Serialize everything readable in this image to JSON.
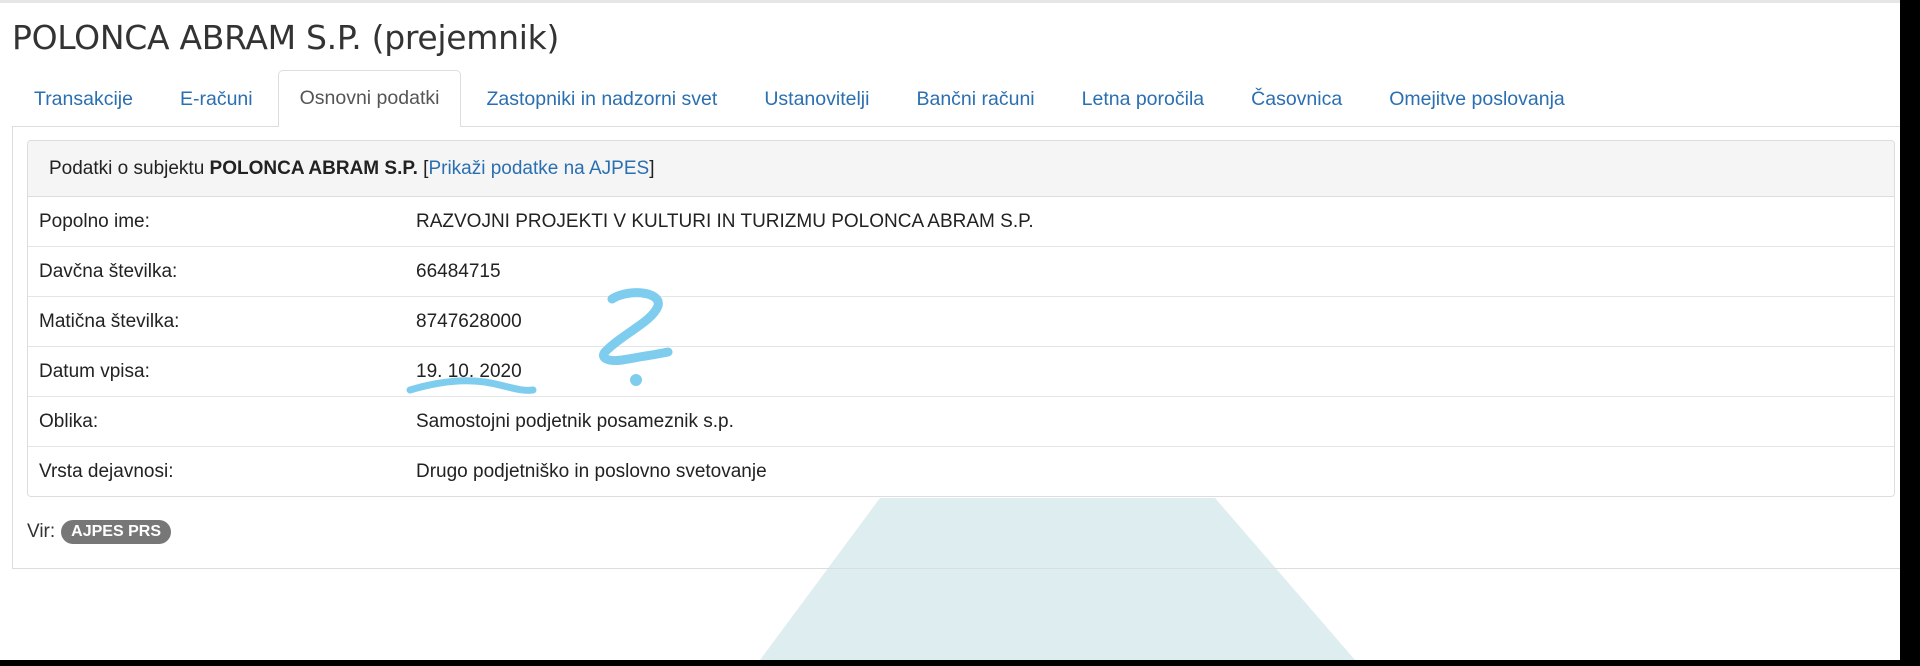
{
  "page": {
    "title": "POLONCA ABRAM S.P. (prejemnik)"
  },
  "tabs": [
    {
      "label": "Transakcije"
    },
    {
      "label": "E-računi"
    },
    {
      "label": "Osnovni podatki"
    },
    {
      "label": "Zastopniki in nadzorni svet"
    },
    {
      "label": "Ustanovitelji"
    },
    {
      "label": "Bančni računi"
    },
    {
      "label": "Letna poročila"
    },
    {
      "label": "Časovnica"
    },
    {
      "label": "Omejitve poslovanja"
    }
  ],
  "active_tab": "Osnovni podatki",
  "panel": {
    "heading_prefix": "Podatki o subjektu",
    "subject_name": "POLONCA ABRAM S.P.",
    "bracket_open": "[",
    "ajpes_link": "Prikaži podatke na AJPES",
    "bracket_close": "]"
  },
  "rows": [
    {
      "label": "Popolno ime:",
      "value": "RAZVOJNI PROJEKTI V KULTURI IN TURIZMU POLONCA ABRAM S.P."
    },
    {
      "label": "Davčna številka:",
      "value": "66484715"
    },
    {
      "label": "Matična številka:",
      "value": "8747628000"
    },
    {
      "label": "Datum vpisa:",
      "value": "19. 10. 2020"
    },
    {
      "label": "Oblika:",
      "value": "Samostojni podjetnik posameznik s.p."
    },
    {
      "label": "Vrsta dejavnosi:",
      "value": "Drugo podjetniško in poslovno svetovanje"
    }
  ],
  "source": {
    "label": "Vir:",
    "badge": "AJPES PRS"
  },
  "colors": {
    "link": "#2a6fb1",
    "badge": "#777777",
    "annotation": "#7fcdee",
    "background_shape": "#deedef"
  },
  "annotation": {
    "glyph": "?",
    "marks": "question-mark-and-underline"
  }
}
